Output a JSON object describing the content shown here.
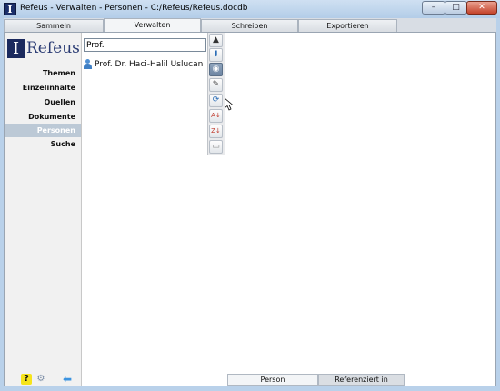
{
  "window": {
    "title": "Refeus - Verwalten - Personen - C:/Refeus/Refeus.docdb",
    "app_icon_letter": "I",
    "controls": {
      "minimize": "–",
      "maximize": "□",
      "close": "✕"
    }
  },
  "tabs": [
    {
      "label": "Sammeln",
      "active": false
    },
    {
      "label": "Verwalten",
      "active": true
    },
    {
      "label": "Schreiben",
      "active": false
    },
    {
      "label": "Exportieren",
      "active": false
    }
  ],
  "logo": {
    "mark": "I",
    "text": "Refeus"
  },
  "sidebar": {
    "items": [
      {
        "label": "Themen",
        "selected": false
      },
      {
        "label": "Einzelinhalte",
        "selected": false
      },
      {
        "label": "Quellen",
        "selected": false
      },
      {
        "label": "Dokumente",
        "selected": false
      },
      {
        "label": "Personen",
        "selected": true
      },
      {
        "label": "Suche",
        "selected": false
      }
    ],
    "bottom_icons": [
      "help-icon",
      "gear-icon",
      "back-arrow-icon"
    ],
    "help_glyph": "?",
    "gear_glyph": "⚙",
    "back_glyph": "⬅"
  },
  "search": {
    "value": "Prof."
  },
  "persons": [
    {
      "name": "Prof. Dr. Haci-Halil Uslucan"
    }
  ],
  "toolbar": {
    "buttons": [
      {
        "icon": "scroll-up-icon",
        "glyph": "▲"
      },
      {
        "icon": "arrow-down-icon",
        "glyph": "⬇"
      },
      {
        "icon": "filter-icon",
        "glyph": "◉"
      },
      {
        "icon": "link-icon",
        "glyph": "✎"
      },
      {
        "icon": "refresh-icon",
        "glyph": "⟳"
      },
      {
        "icon": "sort-az-icon",
        "glyph": "A↓"
      },
      {
        "icon": "sort-za-icon",
        "glyph": "Z↓"
      },
      {
        "icon": "note-icon",
        "glyph": "▭"
      }
    ]
  },
  "detail_tabs": [
    {
      "label": "Person",
      "active": true
    },
    {
      "label": "Referenziert in",
      "active": false
    }
  ],
  "colors": {
    "selected_nav": "#bcc9d6",
    "logo_dark": "#1b2a5e",
    "accent_blue": "#3b93e0"
  }
}
